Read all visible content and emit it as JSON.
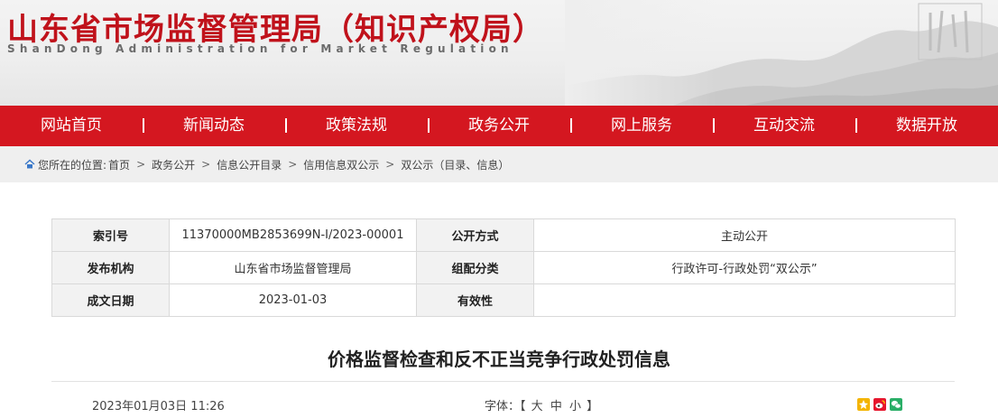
{
  "header": {
    "title": "山东省市场监督管理局（知识产权局）",
    "subtitle": "ShanDong Administration for Market Regulation"
  },
  "nav": [
    {
      "label": "网站首页"
    },
    {
      "label": "新闻动态"
    },
    {
      "label": "政策法规"
    },
    {
      "label": "政务公开"
    },
    {
      "label": "网上服务"
    },
    {
      "label": "互动交流"
    },
    {
      "label": "数据开放"
    }
  ],
  "breadcrumb": {
    "prefix": "您所在的位置:",
    "items": [
      "首页",
      "政务公开",
      "信息公开目录",
      "信用信息双公示",
      "双公示（目录、信息）"
    ],
    "separator": ">"
  },
  "info": {
    "index_label": "索引号",
    "index_value": "11370000MB2853699N-I/2023-00001",
    "method_label": "公开方式",
    "method_value": "主动公开",
    "org_label": "发布机构",
    "org_value": "山东省市场监督管理局",
    "category_label": "组配分类",
    "category_value": "行政许可-行政处罚“双公示”",
    "date_label": "成文日期",
    "date_value": "2023-01-03",
    "validity_label": "有效性",
    "validity_value": ""
  },
  "article": {
    "title": "价格监督检查和反不正当竞争行政处罚信息",
    "datetime": "2023年01月03日 11:26",
    "font_label": "字体：【",
    "font_large": "大",
    "font_medium": "中",
    "font_small": "小",
    "font_close": "】"
  },
  "share": [
    "qzone-icon",
    "weibo-icon",
    "wechat-icon"
  ],
  "colors": {
    "brand_red": "#d41720",
    "title_red": "#c0121b"
  }
}
